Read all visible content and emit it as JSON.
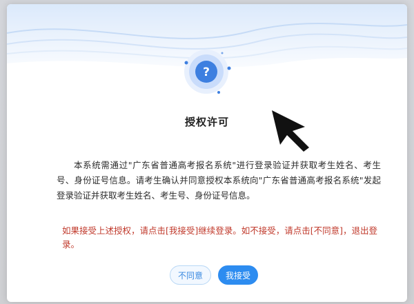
{
  "dialog": {
    "title": "授权许可",
    "body": "本系统需通过\"广东省普通高考报名系统\"进行登录验证并获取考生姓名、考生号、身份证号信息。请考生确认并同意授权本系统向\"广东省普通高考报名系统\"发起登录验证并获取考生姓名、考生号、身份证号信息。",
    "notice": "如果接受上述授权，请点击[我接受]继续登录。如不接受，请点击[不同意]，退出登录。",
    "decline_label": "不同意",
    "accept_label": "我接受"
  },
  "icons": {
    "badge": "question-icon",
    "pointer": "mouse-cursor-icon"
  },
  "colors": {
    "accent": "#2d8cf0",
    "warning": "#c0392b",
    "badge": "#3d7fe0"
  }
}
